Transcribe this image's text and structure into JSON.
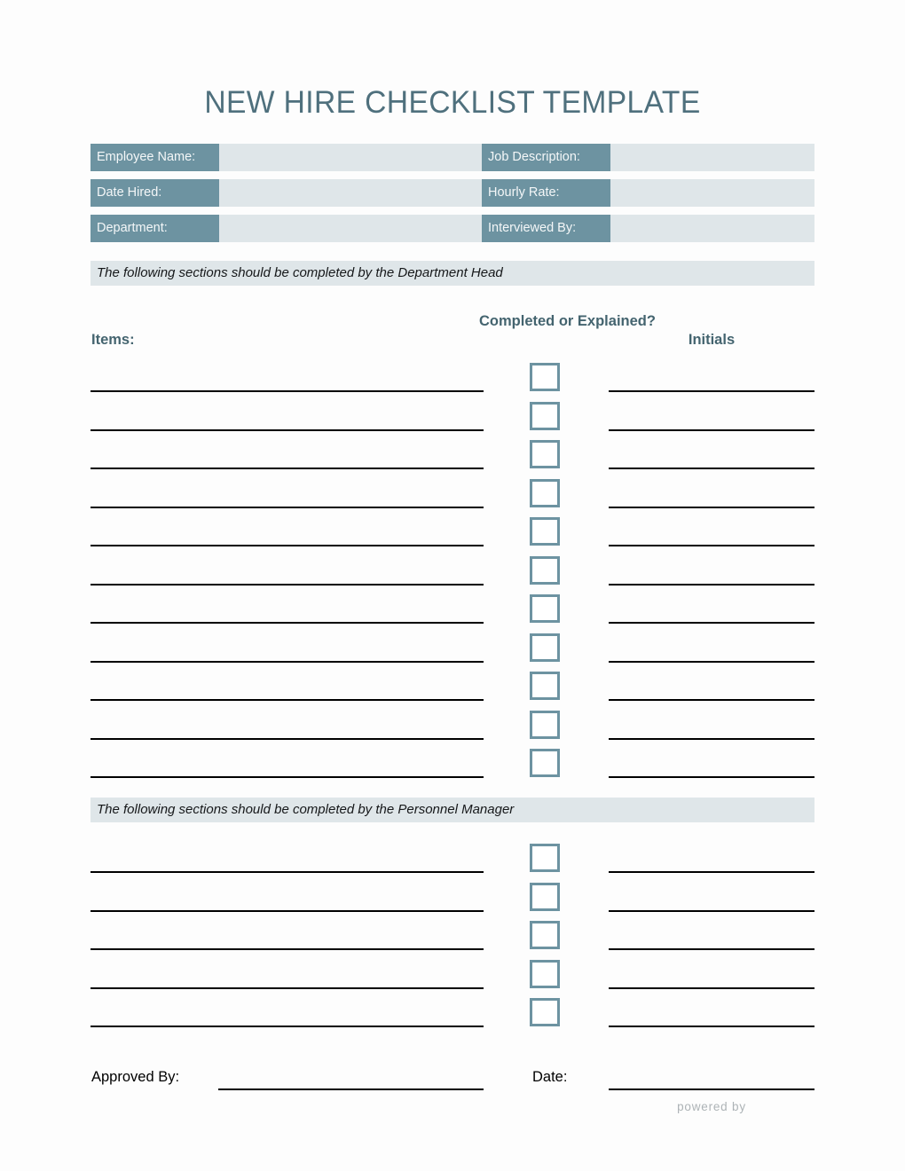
{
  "document": {
    "title": "NEW HIRE CHECKLIST TEMPLATE",
    "accent_color": "#6d93a1",
    "field_bg_color": "#dfe6e9",
    "heading_color": "#4f707d"
  },
  "info_fields": {
    "rows": [
      {
        "left_label": "Employee Name:",
        "left_value": "",
        "right_label": "Job Description:",
        "right_value": ""
      },
      {
        "left_label": "Date Hired:",
        "left_value": "",
        "right_label": "Hourly Rate:",
        "right_value": ""
      },
      {
        "left_label": "Department:",
        "left_value": "",
        "right_label": "Interviewed By:",
        "right_value": ""
      }
    ]
  },
  "section_one": {
    "banner": "The following sections should be completed by the Department Head",
    "headers": {
      "items": "Items:",
      "completed": "Completed or Explained?",
      "initials": "Initials"
    },
    "row_count": 11,
    "rows": [
      {
        "item": "",
        "checked": false,
        "initials": ""
      },
      {
        "item": "",
        "checked": false,
        "initials": ""
      },
      {
        "item": "",
        "checked": false,
        "initials": ""
      },
      {
        "item": "",
        "checked": false,
        "initials": ""
      },
      {
        "item": "",
        "checked": false,
        "initials": ""
      },
      {
        "item": "",
        "checked": false,
        "initials": ""
      },
      {
        "item": "",
        "checked": false,
        "initials": ""
      },
      {
        "item": "",
        "checked": false,
        "initials": ""
      },
      {
        "item": "",
        "checked": false,
        "initials": ""
      },
      {
        "item": "",
        "checked": false,
        "initials": ""
      },
      {
        "item": "",
        "checked": false,
        "initials": ""
      }
    ]
  },
  "section_two": {
    "banner": "The following sections should be completed by the Personnel Manager",
    "row_count": 5,
    "rows": [
      {
        "item": "",
        "checked": false,
        "initials": ""
      },
      {
        "item": "",
        "checked": false,
        "initials": ""
      },
      {
        "item": "",
        "checked": false,
        "initials": ""
      },
      {
        "item": "",
        "checked": false,
        "initials": ""
      },
      {
        "item": "",
        "checked": false,
        "initials": ""
      }
    ]
  },
  "footer": {
    "approved_by_label": "Approved By:",
    "approved_by_value": "",
    "date_label": "Date:",
    "date_value": "",
    "powered_by": "powered by"
  }
}
